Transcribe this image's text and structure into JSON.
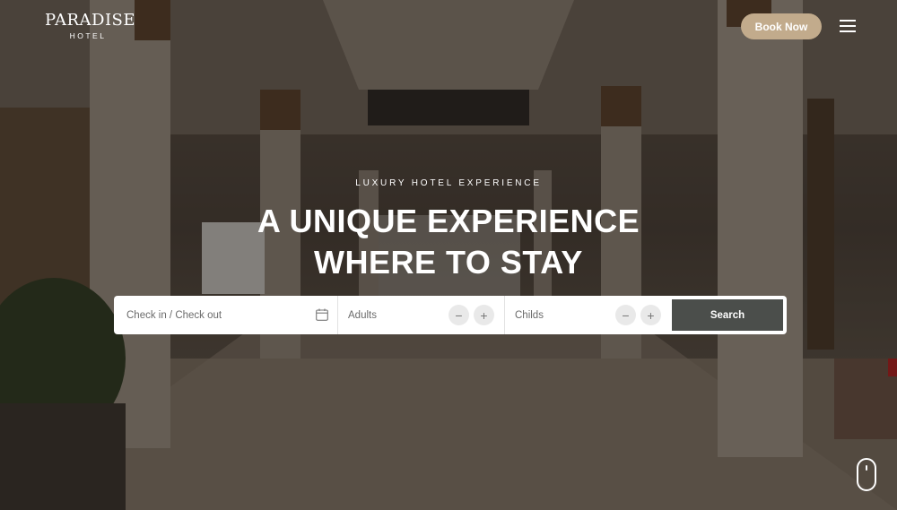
{
  "header": {
    "logo_line1": "PARADISE",
    "logo_line2": "HOTEL",
    "book_now_label": "Book Now",
    "menu_icon": "hamburger-menu-icon"
  },
  "hero": {
    "eyebrow": "LUXURY HOTEL EXPERIENCE",
    "headline_line1": "A UNIQUE EXPERIENCE",
    "headline_line2": "WHERE TO STAY"
  },
  "booking": {
    "date_placeholder": "Check in / Check out",
    "date_icon": "calendar-icon",
    "adults_label": "Adults",
    "childs_label": "Childs",
    "minus_symbol": "−",
    "plus_symbol": "+",
    "search_label": "Search"
  },
  "colors": {
    "accent": "#c2ab8c",
    "search_button": "#4b4e4b"
  },
  "scroll_icon": "mouse-scroll-icon"
}
